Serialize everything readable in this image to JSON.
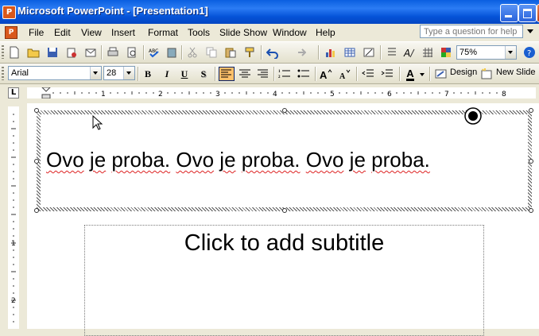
{
  "window": {
    "title": "Microsoft PowerPoint - [Presentation1]"
  },
  "menu": {
    "items": [
      "File",
      "Edit",
      "View",
      "Insert",
      "Format",
      "Tools",
      "Slide Show",
      "Window",
      "Help"
    ],
    "help_placeholder": "Type a question for help"
  },
  "standard_toolbar": {
    "zoom": "75%"
  },
  "formatting_toolbar": {
    "font": "Arial",
    "size": "28",
    "bold": "B",
    "italic": "I",
    "underline": "U",
    "shadow": "S",
    "design_label": "Design",
    "new_slide_label": "New Slide"
  },
  "ruler": {
    "corner": "L",
    "h_numbers": [
      "1",
      "2",
      "3",
      "4",
      "5",
      "6",
      "7",
      "8"
    ],
    "v_numbers": [
      "1",
      "2"
    ]
  },
  "slide": {
    "title_text": "Ovo je proba. Ovo je proba. Ovo je proba.",
    "title_words": [
      "Ovo",
      "je",
      "proba.",
      "Ovo",
      "je",
      "proba.",
      "Ovo",
      "je",
      "proba."
    ],
    "subtitle_placeholder": "Click to add subtitle"
  },
  "colors": {
    "title_bar": "#0553d8",
    "spell_underline": "#dd2222",
    "active_button": "#ffc06a"
  }
}
